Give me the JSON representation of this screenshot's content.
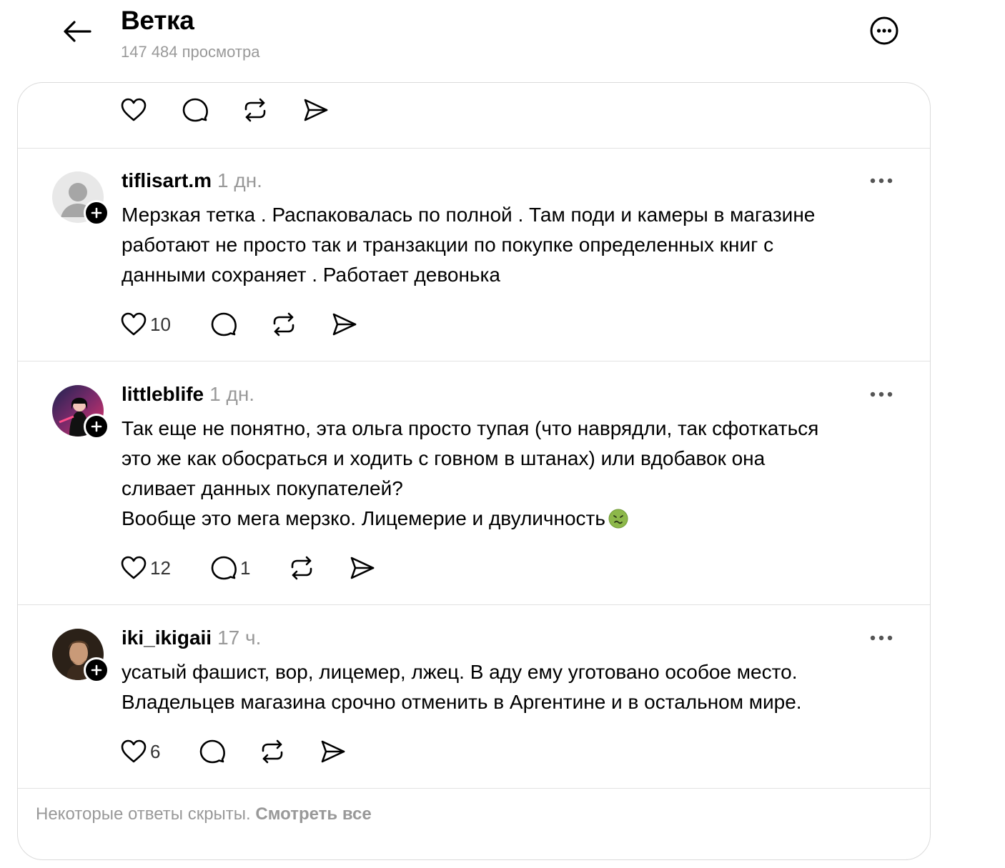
{
  "header": {
    "title": "Ветка",
    "views": "147 484 просмотра"
  },
  "icons": {
    "back": "arrow-left-icon",
    "more": "more-circle-icon",
    "like": "heart-icon",
    "reply": "comment-bubble-icon",
    "repost": "repost-icon",
    "share": "send-icon",
    "post_more": "three-dots-icon",
    "follow": "plus-icon"
  },
  "posts": [
    {
      "username": "tiflisart.m",
      "time": "1 дн.",
      "lines": [
        "Мерзкая тетка . Распаковалась по полной . Там поди и камеры в магазине",
        "работают не просто так и транзакции по покупке определенных книг с",
        "данными сохраняет . Работает девонька"
      ],
      "likes": "10",
      "replies": ""
    },
    {
      "username": "littleblife",
      "time": "1 дн.",
      "lines": [
        "Так еще не понятно, эта ольга просто тупая (что наврядли, так сфоткаться",
        "это же как обосраться и ходить с говном в штанах) или вдобавок она",
        "сливает данных покупателей?",
        "Вообще это мега мерзко. Лицемерие и двуличность"
      ],
      "emoji": "nauseated-face-emoji",
      "likes": "12",
      "replies": "1"
    },
    {
      "username": "iki_ikigaii",
      "time": "17 ч.",
      "lines": [
        "усатый фашист, вор, лицемер, лжец. В аду ему уготовано особое место.",
        "Владельцев магазина срочно отменить в Аргентине и в остальном мире."
      ],
      "likes": "6",
      "replies": ""
    }
  ],
  "footer": {
    "hidden_text": "Некоторые ответы скрыты.",
    "see_all": "Смотреть все"
  }
}
